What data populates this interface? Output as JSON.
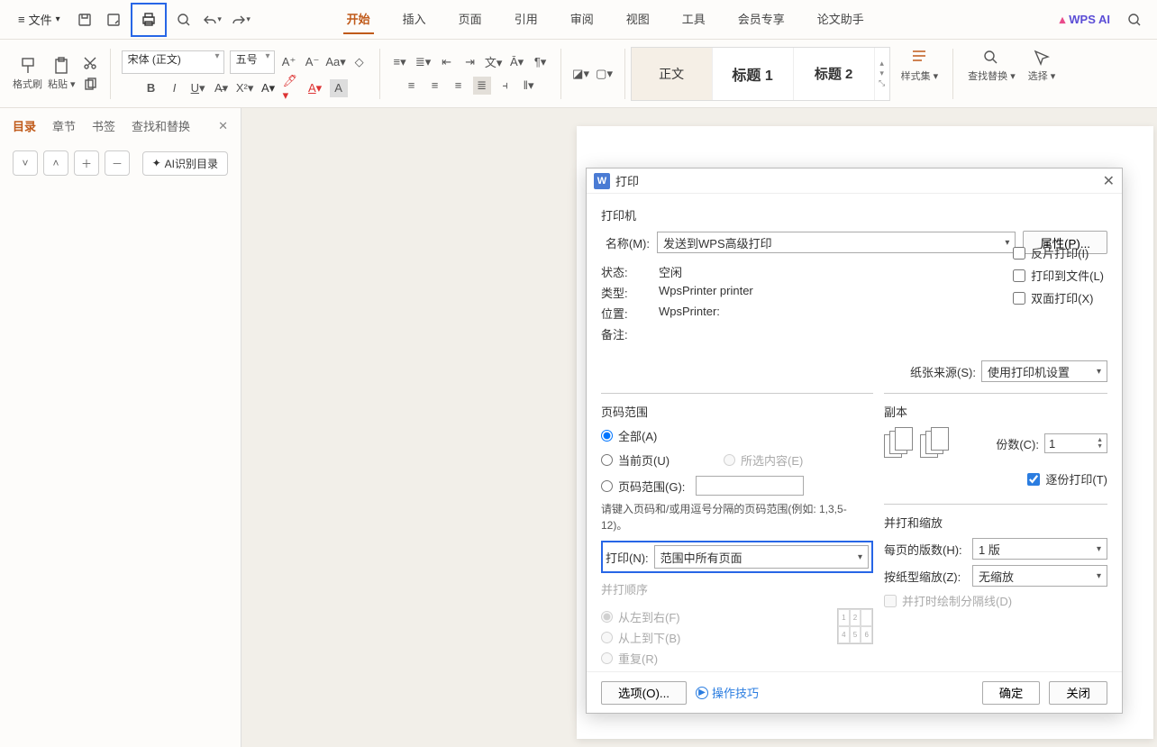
{
  "menubar": {
    "file": "文件",
    "tabs": [
      "开始",
      "插入",
      "页面",
      "引用",
      "审阅",
      "视图",
      "工具",
      "会员专享",
      "论文助手"
    ],
    "activeTab": 0,
    "wps_ai": "WPS AI"
  },
  "ribbon": {
    "format_painter": "格式刷",
    "paste": "粘贴",
    "font_name": "宋体 (正文)",
    "font_size": "五号",
    "styles": [
      "正文",
      "标题 1",
      "标题 2"
    ],
    "style_set": "样式集",
    "find_replace": "查找替换",
    "select": "选择"
  },
  "leftpanel": {
    "tabs": [
      "目录",
      "章节",
      "书签",
      "查找和替换"
    ],
    "ai_toc": "AI识别目录"
  },
  "dialog": {
    "title": "打印",
    "printer_section": "打印机",
    "name_label": "名称(M):",
    "name_value": "发送到WPS高级打印",
    "properties_btn": "属性(P)...",
    "status_label": "状态:",
    "status_value": "空闲",
    "type_label": "类型:",
    "type_value": "WpsPrinter printer",
    "location_label": "位置:",
    "location_value": "WpsPrinter:",
    "comment_label": "备注:",
    "mirror_print": "反片打印(I)",
    "print_to_file": "打印到文件(L)",
    "duplex": "双面打印(X)",
    "paper_source_label": "纸张来源(S):",
    "paper_source_value": "使用打印机设置",
    "page_range_section": "页码范围",
    "all": "全部(A)",
    "current": "当前页(U)",
    "selection": "所选内容(E)",
    "pages": "页码范围(G):",
    "hint": "请键入页码和/或用逗号分隔的页码范围(例如: 1,3,5-12)。",
    "print_n_label": "打印(N):",
    "print_n_value": "范围中所有页面",
    "order_section": "并打顺序",
    "ltr": "从左到右(F)",
    "ttb": "从上到下(B)",
    "repeat": "重复(R)",
    "copies_section": "副本",
    "copies_label": "份数(C):",
    "copies_value": "1",
    "collate": "逐份打印(T)",
    "zoom_section": "并打和缩放",
    "pages_per_sheet_label": "每页的版数(H):",
    "pages_per_sheet_value": "1 版",
    "scale_label": "按纸型缩放(Z):",
    "scale_value": "无缩放",
    "draw_lines": "并打时绘制分隔线(D)",
    "options_btn": "选项(O)...",
    "tips": "操作技巧",
    "ok": "确定",
    "cancel": "关闭"
  }
}
